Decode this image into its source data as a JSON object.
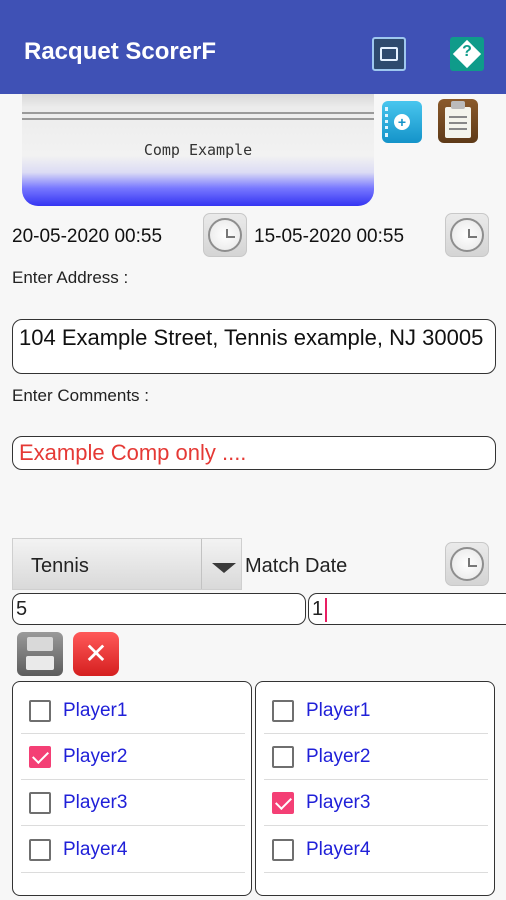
{
  "app": {
    "title": "Racquet ScorerF",
    "header_icons": [
      "device-icon",
      "help-icon"
    ],
    "bar_color": "#3f51b5"
  },
  "banner": {
    "title": "Comp Example"
  },
  "dates": {
    "start": "20-05-2020 00:55",
    "end": "15-05-2020 00:55"
  },
  "address": {
    "label": "Enter Address :",
    "value": "104 Example Street, Tennis example, NJ 30005"
  },
  "comments": {
    "label": "Enter Comments :",
    "value": "Example Comp only ....",
    "color": "#e53935"
  },
  "sport": {
    "selected": "Tennis"
  },
  "match": {
    "date_label": "Match Date",
    "field_1": "5",
    "field_2": "1"
  },
  "players_left": [
    {
      "name": "Player1",
      "checked": false
    },
    {
      "name": "Player2",
      "checked": true
    },
    {
      "name": "Player3",
      "checked": false
    },
    {
      "name": "Player4",
      "checked": false
    }
  ],
  "players_right": [
    {
      "name": "Player1",
      "checked": false
    },
    {
      "name": "Player2",
      "checked": false
    },
    {
      "name": "Player3",
      "checked": true
    },
    {
      "name": "Player4",
      "checked": false
    }
  ],
  "check_color": "#f43f75",
  "player_text_color": "#2020d8"
}
